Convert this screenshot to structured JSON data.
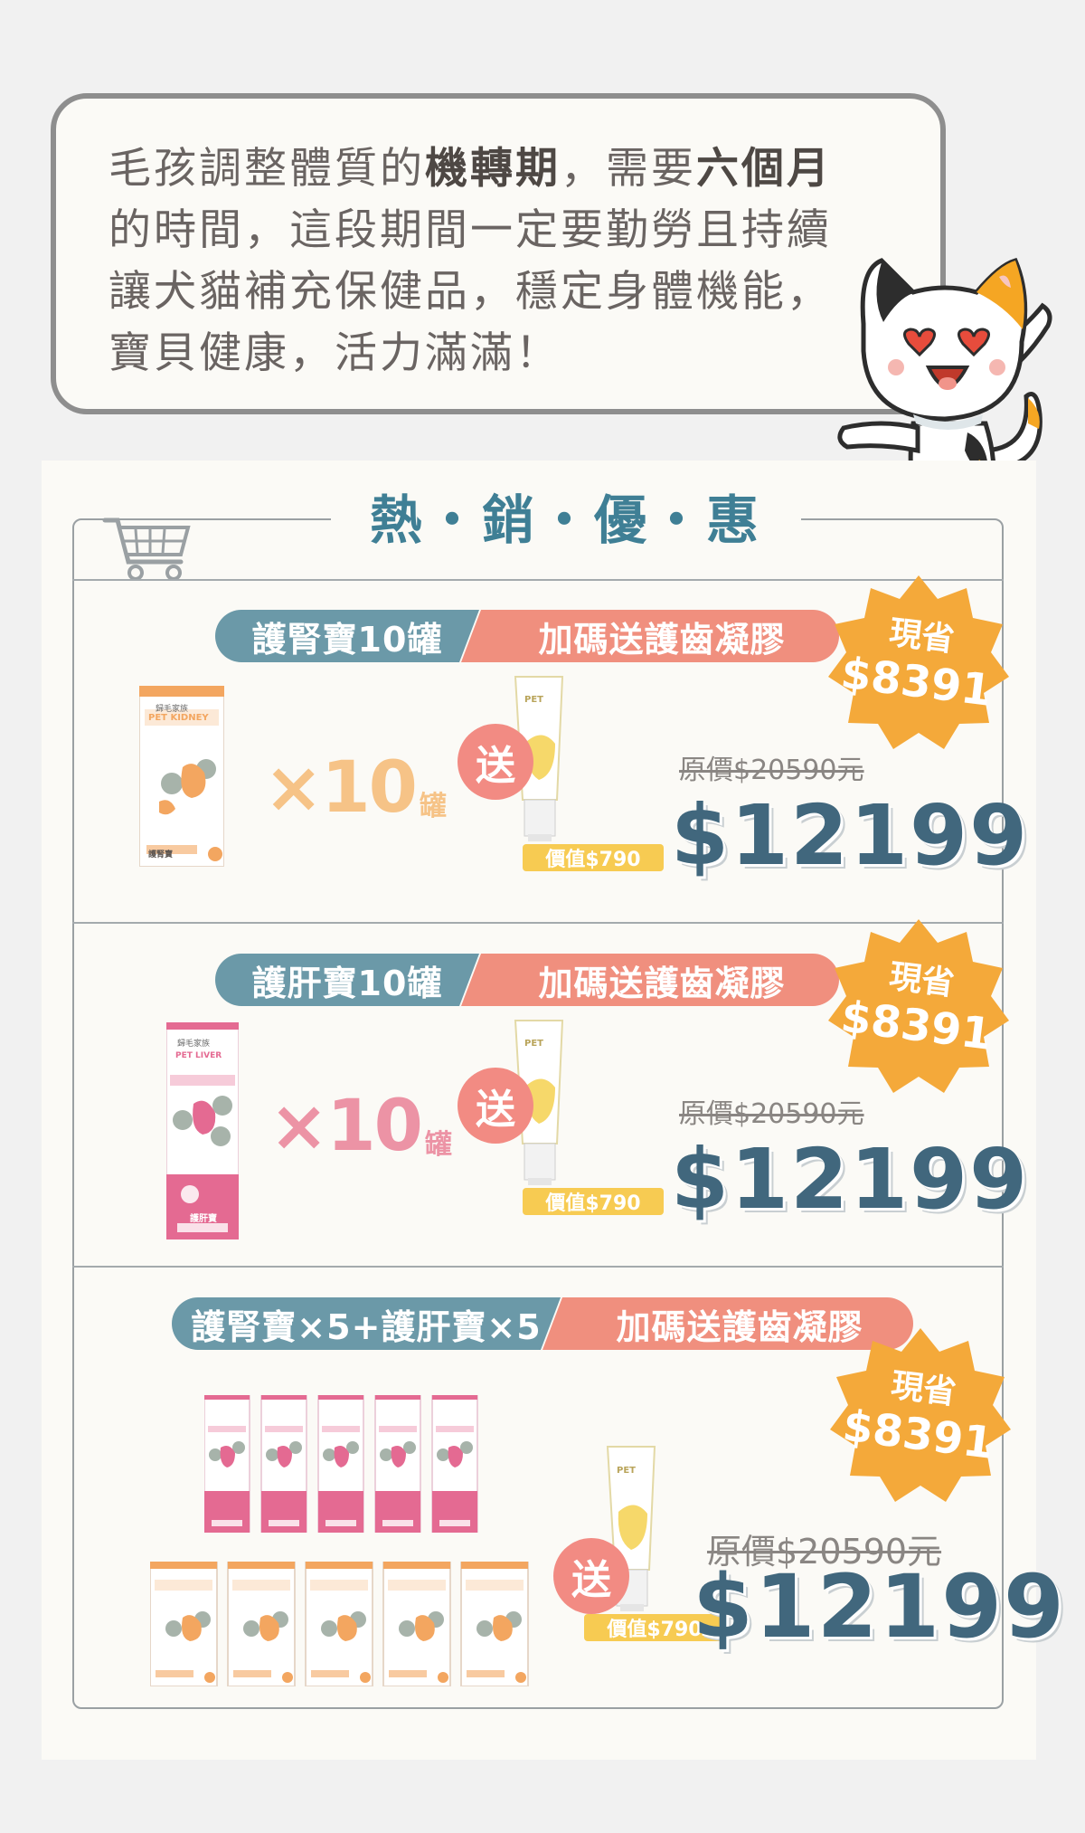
{
  "intro": {
    "l1_a": "毛孩調整體質的",
    "l1_b": "機轉期",
    "l1_c": "，需要",
    "l1_d": "六個月",
    "l2": "的時間，這段期間一定要勤勞且持續",
    "l3": "讓犬貓補充保健品，穩定身體機能，",
    "l4": "寶貝健康，活力滿滿！"
  },
  "section": {
    "title": "熱・銷・優・惠"
  },
  "offers": [
    {
      "product": "護腎寶10罐",
      "bonus": "加碼送護齒凝膠",
      "quantity": "×10",
      "unit": "罐",
      "gift_label": "送",
      "gift_value": "價值$790",
      "badge_line1": "現省",
      "badge_line2": "$8391",
      "original_price": "原價$20590元",
      "price": "$12199",
      "box_brand": "歸毛家族",
      "box_name": "PET KIDNEY",
      "box_label": "護腎寶"
    },
    {
      "product": "護肝寶10罐",
      "bonus": "加碼送護齒凝膠",
      "quantity": "×10",
      "unit": "罐",
      "gift_label": "送",
      "gift_value": "價值$790",
      "badge_line1": "現省",
      "badge_line2": "$8391",
      "original_price": "原價$20590元",
      "price": "$12199",
      "box_brand": "歸毛家族",
      "box_name": "PET LIVER",
      "box_label": "護肝寶"
    },
    {
      "product": "護腎寶×5+護肝寶×5",
      "bonus": "加碼送護齒凝膠",
      "gift_label": "送",
      "gift_value": "價值$790",
      "badge_line1": "現省",
      "badge_line2": "$8391",
      "original_price": "原價$20590元",
      "price": "$12199"
    }
  ],
  "tube_label": "PET",
  "colors": {
    "teal": "#3f7f95",
    "pill_blue": "#6b99a8",
    "pill_coral": "#f08f7e",
    "badge_orange": "#f4a93a",
    "price_navy": "#41677d",
    "kidney_orange": "#f3a660",
    "liver_pink": "#e46a92"
  },
  "icons": [
    "shopping-cart-icon",
    "cat-mascot"
  ]
}
